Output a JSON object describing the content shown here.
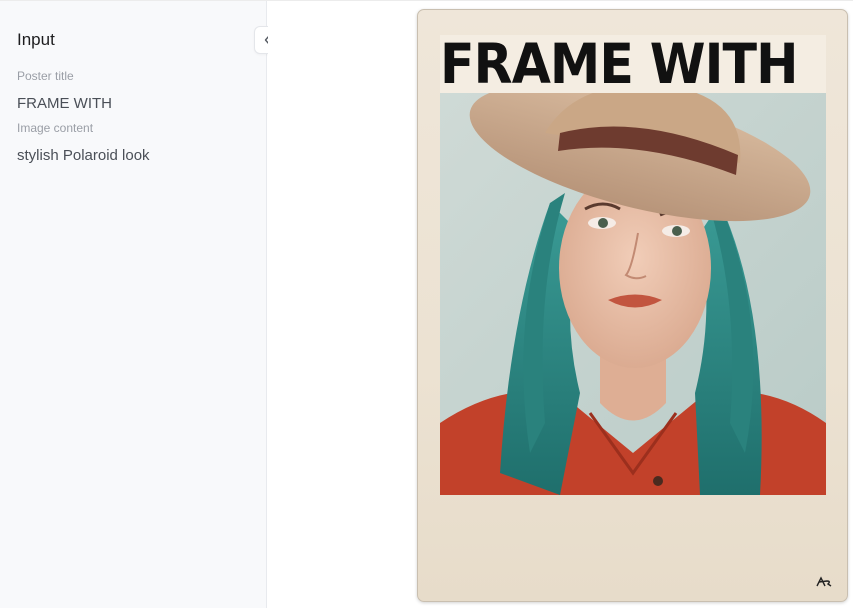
{
  "sidebar": {
    "title": "Input",
    "fields": [
      {
        "label": "Poster title",
        "value": "FRAME WITH"
      },
      {
        "label": "Image content",
        "value": "stylish Polaroid look"
      }
    ],
    "collapse_icon": "double-chevron-left-icon"
  },
  "poster": {
    "title": "FRAME WITH",
    "image_icon": "portrait-photo",
    "signature_icon": "signature-mark"
  },
  "colors": {
    "sidebar_bg": "#f8f9fb",
    "poster_frame": "#ece2d2",
    "title_text": "#111111",
    "hair_teal": "#2e8f8a",
    "shirt_red": "#c2412a",
    "hat_tan": "#c9a98a"
  }
}
